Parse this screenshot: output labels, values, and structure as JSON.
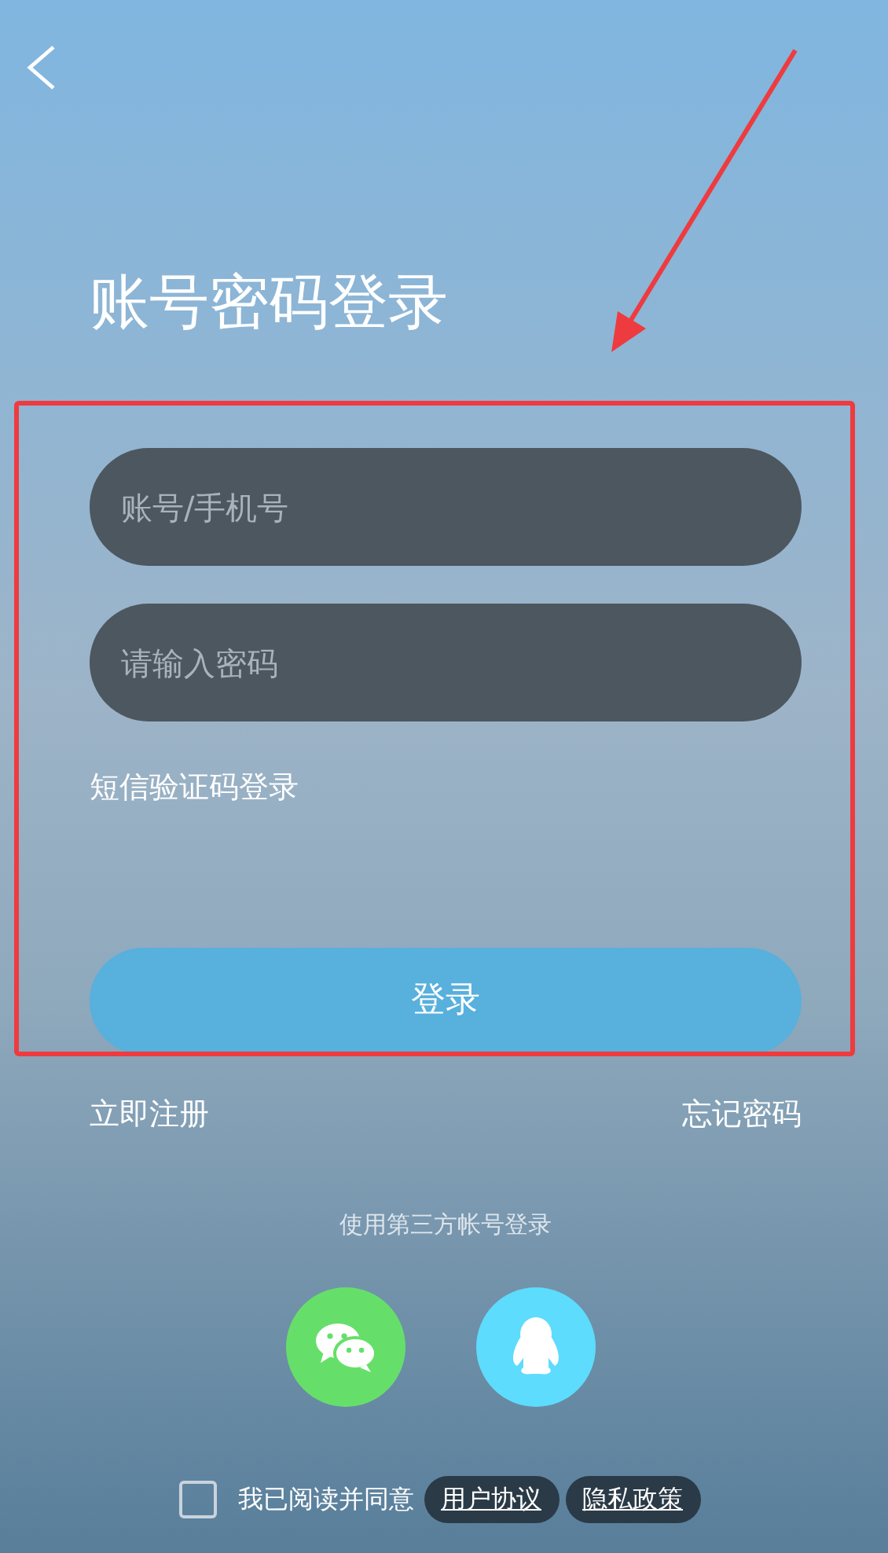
{
  "title": "账号密码登录",
  "fields": [
    {
      "placeholder": "账号/手机号"
    },
    {
      "placeholder": "请输入密码"
    }
  ],
  "sms_login": "短信验证码登录",
  "login_button": "登录",
  "links": [
    "立即注册",
    "忘记密码"
  ],
  "third_party": {
    "label": "使用第三方帐号登录",
    "providers": [
      {
        "kind": "chat",
        "color": "#66df6a"
      },
      {
        "kind": "penguin",
        "color": "#5ddcfd"
      }
    ]
  },
  "agreement": {
    "checked": false,
    "text": "我已阅读并同意",
    "documents": [
      "用户协议",
      "隐私政策"
    ]
  }
}
